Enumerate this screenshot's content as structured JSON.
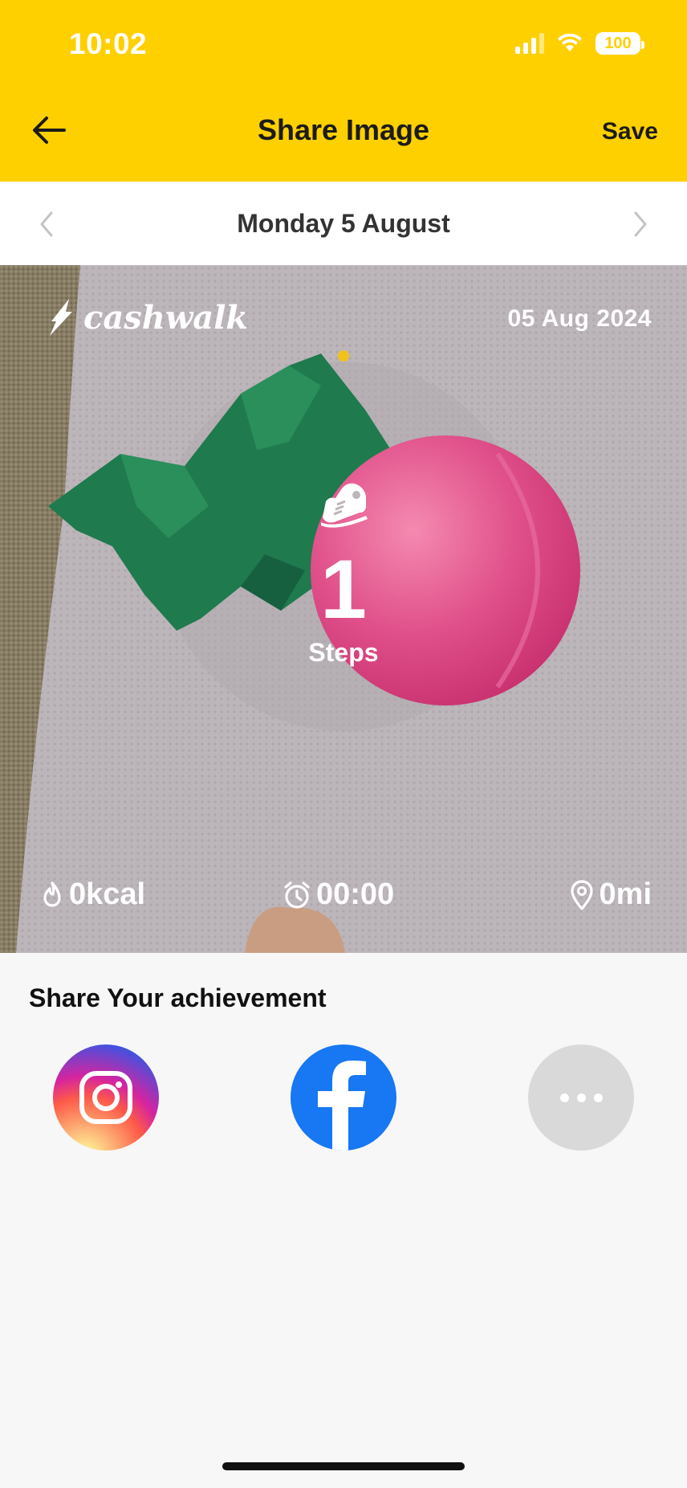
{
  "status_bar": {
    "time": "10:02",
    "battery": "100"
  },
  "header": {
    "title": "Share Image",
    "save_label": "Save"
  },
  "date_nav": {
    "label": "Monday 5 August"
  },
  "photo_card": {
    "brand": "cashwalk",
    "date": "05 Aug 2024",
    "steps": "1",
    "steps_label": "Steps",
    "calories": "0kcal",
    "duration": "00:00",
    "distance": "0mi"
  },
  "share": {
    "title": "Share Your achievement",
    "options": [
      "instagram-icon",
      "facebook-icon",
      "more-icon"
    ]
  },
  "colors": {
    "header_bg": "#ffd000",
    "facebook": "#1877f2",
    "more_bg": "#d9d9d9"
  }
}
